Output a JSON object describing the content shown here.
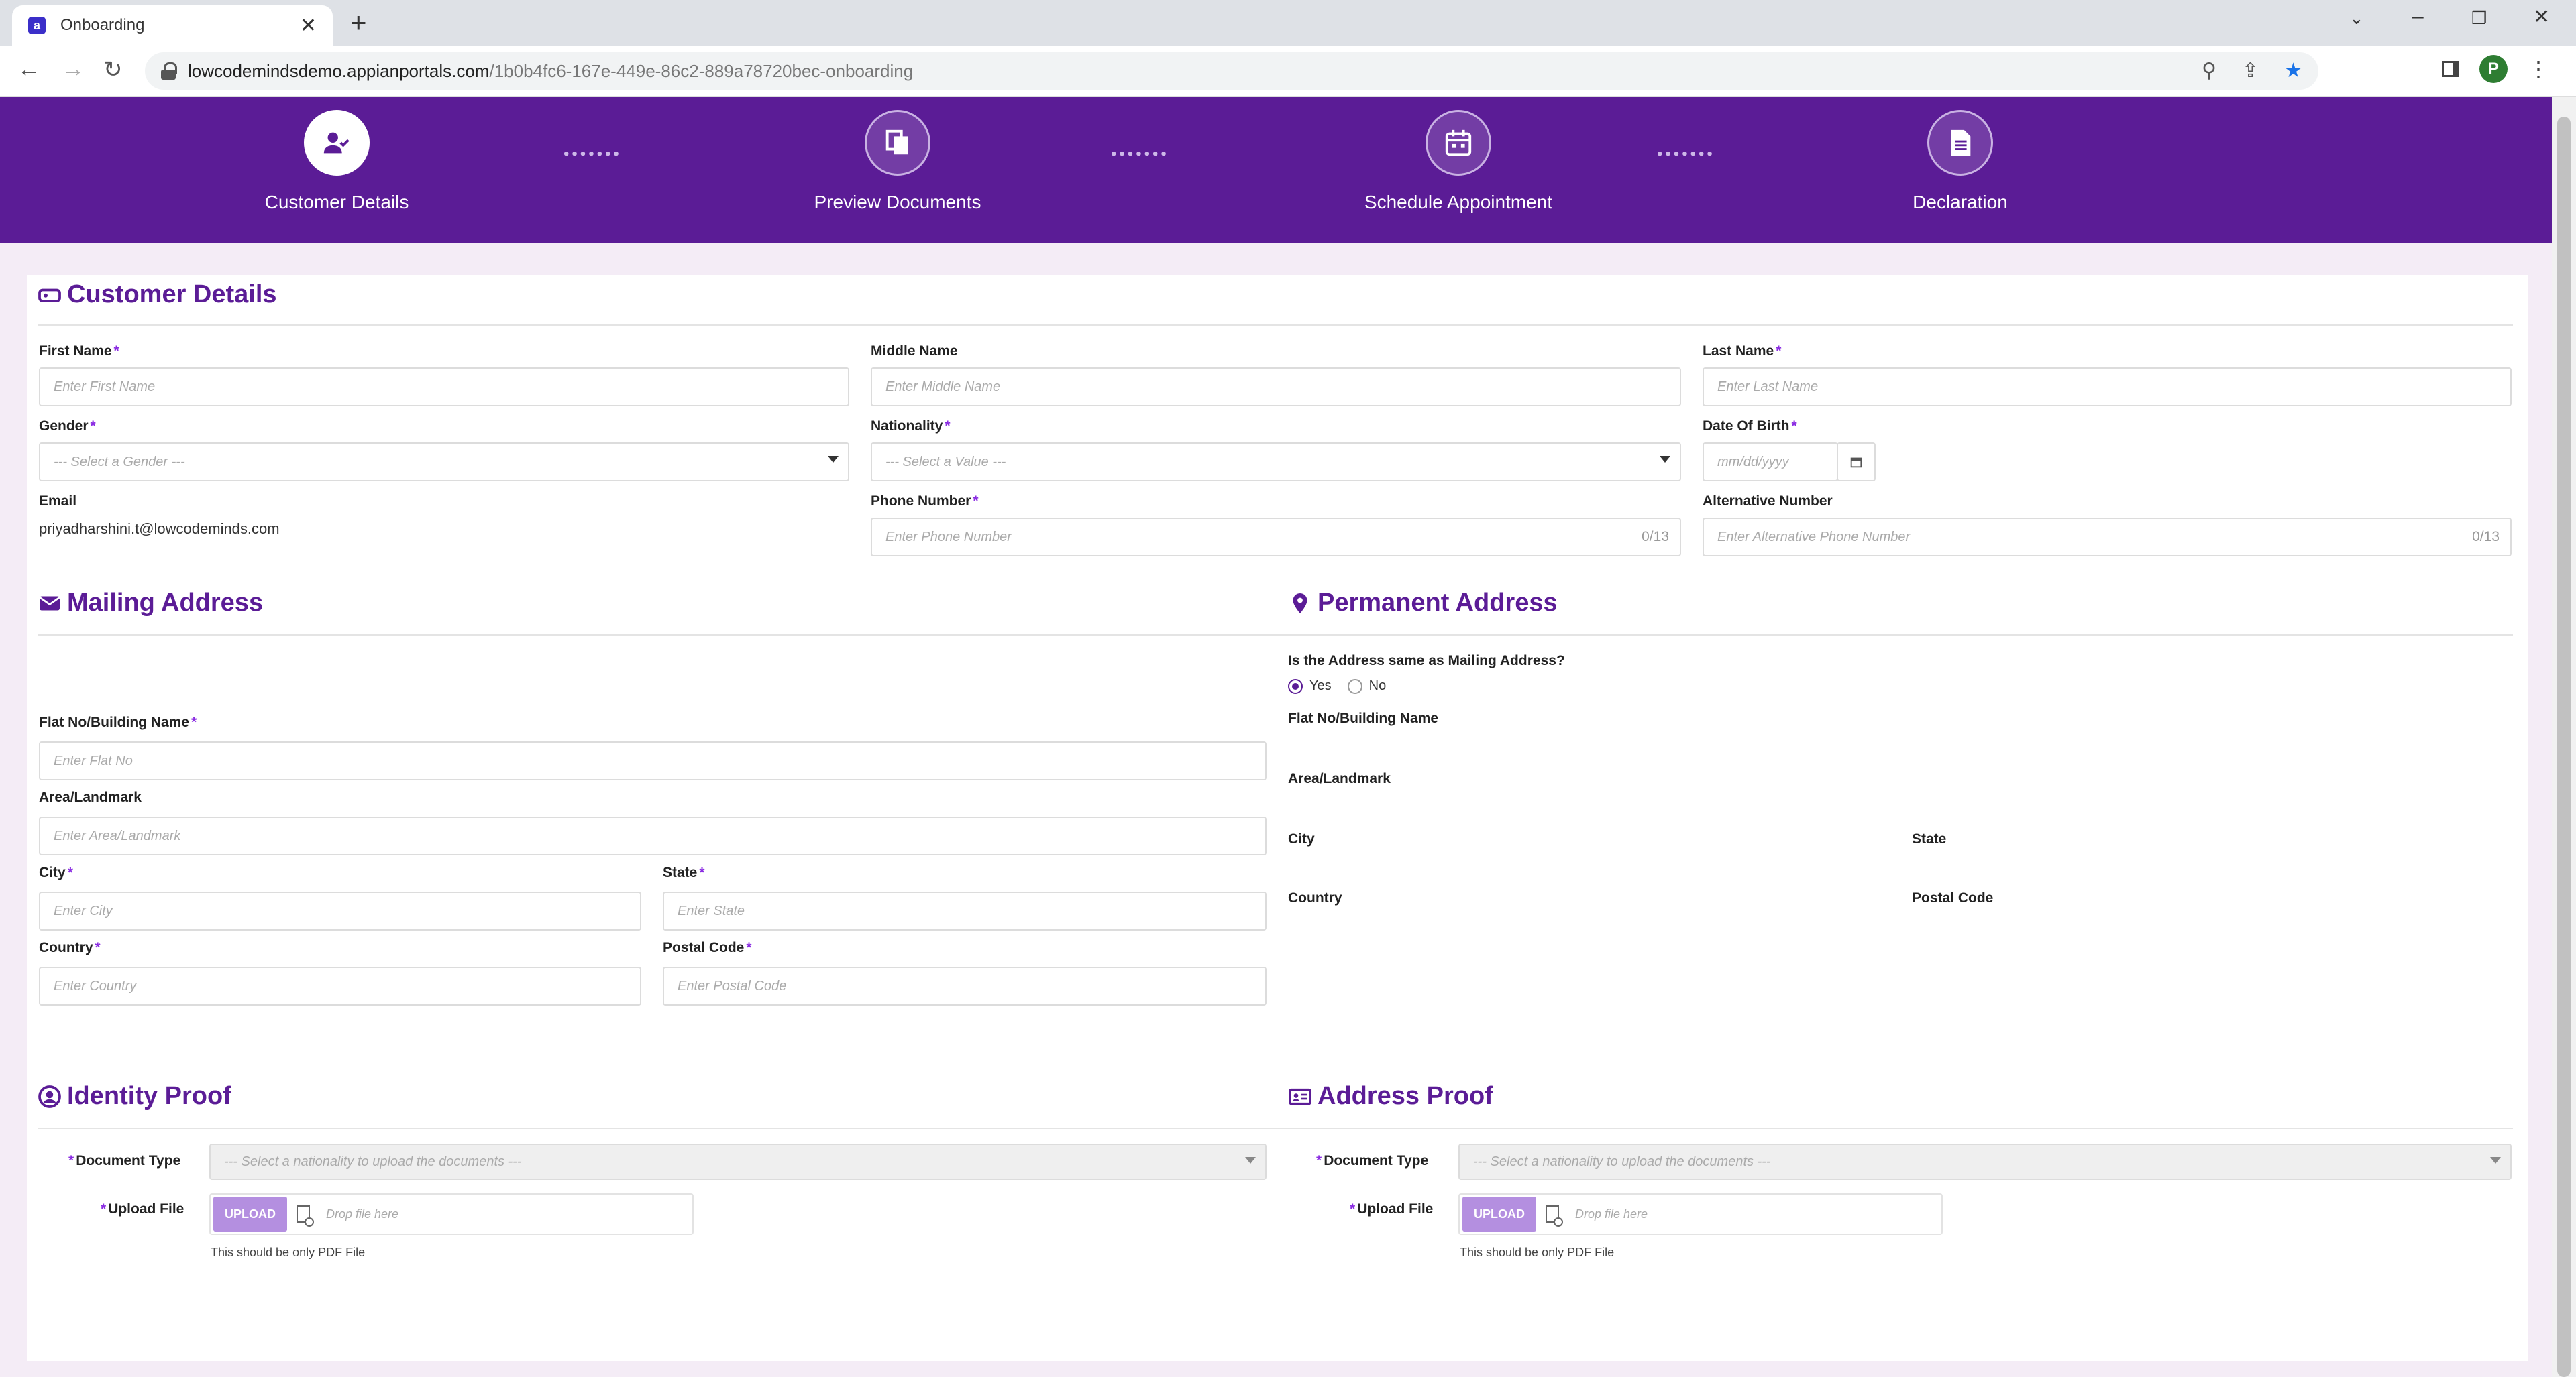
{
  "browser": {
    "tab_title": "Onboarding",
    "url_host": "lowcodemindsdemo.appianportals.com",
    "url_path": "/1b0b4fc6-167e-449e-86c2-889a78720bec-onboarding",
    "profile_initial": "P"
  },
  "stepper": {
    "steps": [
      {
        "label": "Customer Details",
        "icon": "user-check-icon",
        "active": true
      },
      {
        "label": "Preview Documents",
        "icon": "documents-icon",
        "active": false
      },
      {
        "label": "Schedule Appointment",
        "icon": "calendar-icon",
        "active": false
      },
      {
        "label": "Declaration",
        "icon": "document-icon",
        "active": false
      }
    ],
    "connector": "•••••••"
  },
  "customer_details": {
    "title": "Customer Details",
    "first_name": {
      "label": "First Name",
      "required": "*",
      "placeholder": "Enter First Name"
    },
    "middle_name": {
      "label": "Middle Name",
      "placeholder": "Enter Middle Name"
    },
    "last_name": {
      "label": "Last Name",
      "required": "*",
      "placeholder": "Enter Last Name"
    },
    "gender": {
      "label": "Gender",
      "required": "*",
      "value": "--- Select a Gender ---"
    },
    "nationality": {
      "label": "Nationality",
      "required": "*",
      "value": "--- Select a Value ---"
    },
    "dob": {
      "label": "Date Of Birth",
      "required": "*",
      "placeholder": "mm/dd/yyyy"
    },
    "email": {
      "label": "Email",
      "value": "priyadharshini.t@lowcodeminds.com"
    },
    "phone": {
      "label": "Phone Number",
      "required": "*",
      "placeholder": "Enter Phone Number",
      "counter": "0/13"
    },
    "alt_phone": {
      "label": "Alternative Number",
      "placeholder": "Enter Alternative Phone Number",
      "counter": "0/13"
    }
  },
  "mailing_address": {
    "title": "Mailing Address",
    "flat": {
      "label": "Flat No/Building Name",
      "required": "*",
      "placeholder": "Enter Flat No"
    },
    "area": {
      "label": "Area/Landmark",
      "placeholder": "Enter Area/Landmark"
    },
    "city": {
      "label": "City",
      "required": "*",
      "placeholder": "Enter City"
    },
    "state": {
      "label": "State",
      "required": "*",
      "placeholder": "Enter State"
    },
    "country": {
      "label": "Country",
      "required": "*",
      "placeholder": "Enter Country"
    },
    "postal": {
      "label": "Postal Code",
      "required": "*",
      "placeholder": "Enter Postal Code"
    }
  },
  "permanent_address": {
    "title": "Permanent Address",
    "question": "Is the Address same as Mailing Address?",
    "yes": "Yes",
    "no": "No",
    "flat_label": "Flat No/Building Name",
    "area_label": "Area/Landmark",
    "city_label": "City",
    "state_label": "State",
    "country_label": "Country",
    "postal_label": "Postal Code"
  },
  "identity_proof": {
    "title": "Identity Proof",
    "doc_type_label": "Document Type",
    "doc_type_value": "--- Select a nationality to upload the documents ---",
    "upload_label": "Upload File",
    "upload_button": "UPLOAD",
    "drop_text": "Drop file here",
    "hint": "This should be only PDF File"
  },
  "address_proof": {
    "title": "Address Proof",
    "doc_type_label": "Document Type",
    "doc_type_value": "--- Select a nationality to upload the documents ---",
    "upload_label": "Upload File",
    "upload_button": "UPLOAD",
    "drop_text": "Drop file here",
    "hint": "This should be only PDF File"
  },
  "colors": {
    "brand_purple": "#5b1c96",
    "upload_button": "#b48fe0",
    "page_bg": "#f4ecf6"
  }
}
